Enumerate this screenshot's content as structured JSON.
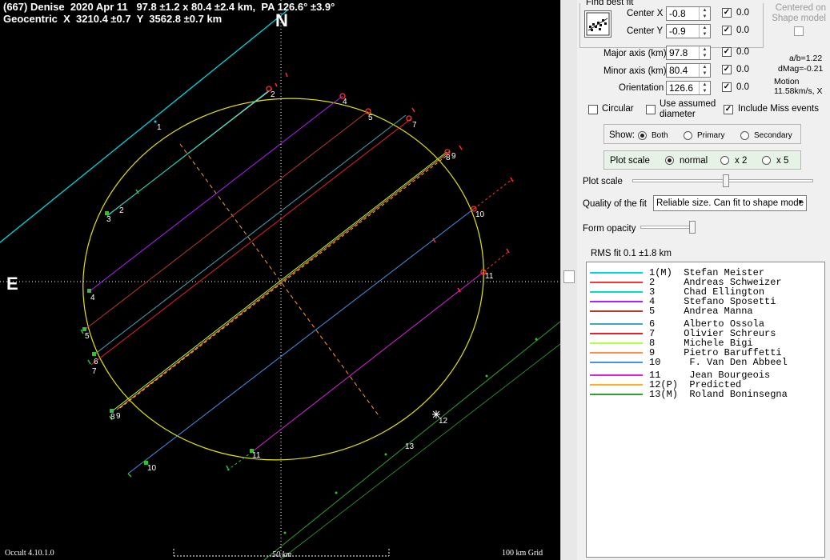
{
  "header": {
    "line1": "(667) Denise  2020 Apr 11   97.8 ±1.2 x 80.4 ±2.4 km,  PA 126.6° ±3.9°",
    "line2": "Geocentric  X  3210.4 ±0.7  Y  3562.8 ±0.7 km"
  },
  "compass": {
    "north": "N",
    "east": "E"
  },
  "footer": {
    "version": "Occult 4.10.1.0",
    "scale": "50 km",
    "grid": "100 km Grid"
  },
  "plot": {
    "chord_labels": [
      "1",
      "2",
      "3",
      "4",
      "5",
      "6",
      "7",
      "8",
      "9",
      "10",
      "11",
      "12",
      "13"
    ],
    "colors": {
      "ellipse": "#e6e600",
      "axis": "#ff9a2e",
      "grid": "#ffffff",
      "c1": "#00d8e0",
      "c2": "#ff3333",
      "c3": "#00e0c0",
      "c4": "#b020ff",
      "c5": "#b83a2a",
      "c6": "#40a8b8",
      "c7": "#e8202e",
      "c8": "#b0ff40",
      "c9": "#ff9040",
      "c10": "#4a90e8",
      "c11": "#e020e0",
      "c12": "#ffb020",
      "c13": "#30a030"
    }
  },
  "panel": {
    "find_best_fit": "Find best fit",
    "center_x_label": "Center X",
    "center_x": "-0.8",
    "center_x_val": "0.0",
    "center_y_label": "Center Y",
    "center_y": "-0.9",
    "center_y_val": "0.0",
    "centered_on_shape": "Centered on Shape model",
    "major_label": "Major axis (km)",
    "major": "97.8",
    "major_val": "0.0",
    "minor_label": "Minor axis (km)",
    "minor": "80.4",
    "minor_val": "0.0",
    "orient_label": "Orientation",
    "orient": "126.6",
    "orient_val": "0.0",
    "ab": "a/b=1.22",
    "dmag": "dMag=-0.21",
    "motion": "Motion",
    "motion_val": "11.58km/s, X",
    "circular": "Circular",
    "use_assumed": "Use assumed diameter",
    "include_miss": "Include Miss events",
    "show_label": "Show:",
    "show_both": "Both",
    "show_primary": "Primary",
    "show_secondary": "Secondary",
    "plot_scale_group": "Plot scale",
    "scale_normal": "normal",
    "scale_x2": "x 2",
    "scale_x5": "x 5",
    "plot_scale_slider": "Plot scale",
    "quality_label": "Quality of the fit",
    "quality_value": "Reliable size. Can fit to shape mode",
    "form_opacity": "Form opacity",
    "rms_fit": "RMS fit 0.1 ±1.8 km"
  },
  "legend": [
    {
      "text": "1(M)  Stefan Meister",
      "color": "#00d8e0"
    },
    {
      "text": "2     Andreas Schweizer",
      "color": "#ff3333"
    },
    {
      "text": "3     Chad Ellington",
      "color": "#00e0c0"
    },
    {
      "text": "4     Stefano Sposetti",
      "color": "#b020ff"
    },
    {
      "text": "5     Andrea Manna",
      "color": "#b83a2a"
    },
    {
      "text": "6     Alberto Ossola",
      "color": "#40a8b8"
    },
    {
      "text": "7     Olivier Schreurs",
      "color": "#e8202e"
    },
    {
      "text": "8     Michele Bigi",
      "color": "#b0ff40"
    },
    {
      "text": "9     Pietro Baruffetti",
      "color": "#ff9040"
    },
    {
      "text": "10     F. Van Den Abbeel",
      "color": "#4a90e8"
    },
    {
      "text": "11     Jean Bourgeois",
      "color": "#e020e0"
    },
    {
      "text": "12(P)  Predicted",
      "color": "#ffb020"
    },
    {
      "text": "13(M)  Roland Boninsegna",
      "color": "#30a030"
    }
  ]
}
